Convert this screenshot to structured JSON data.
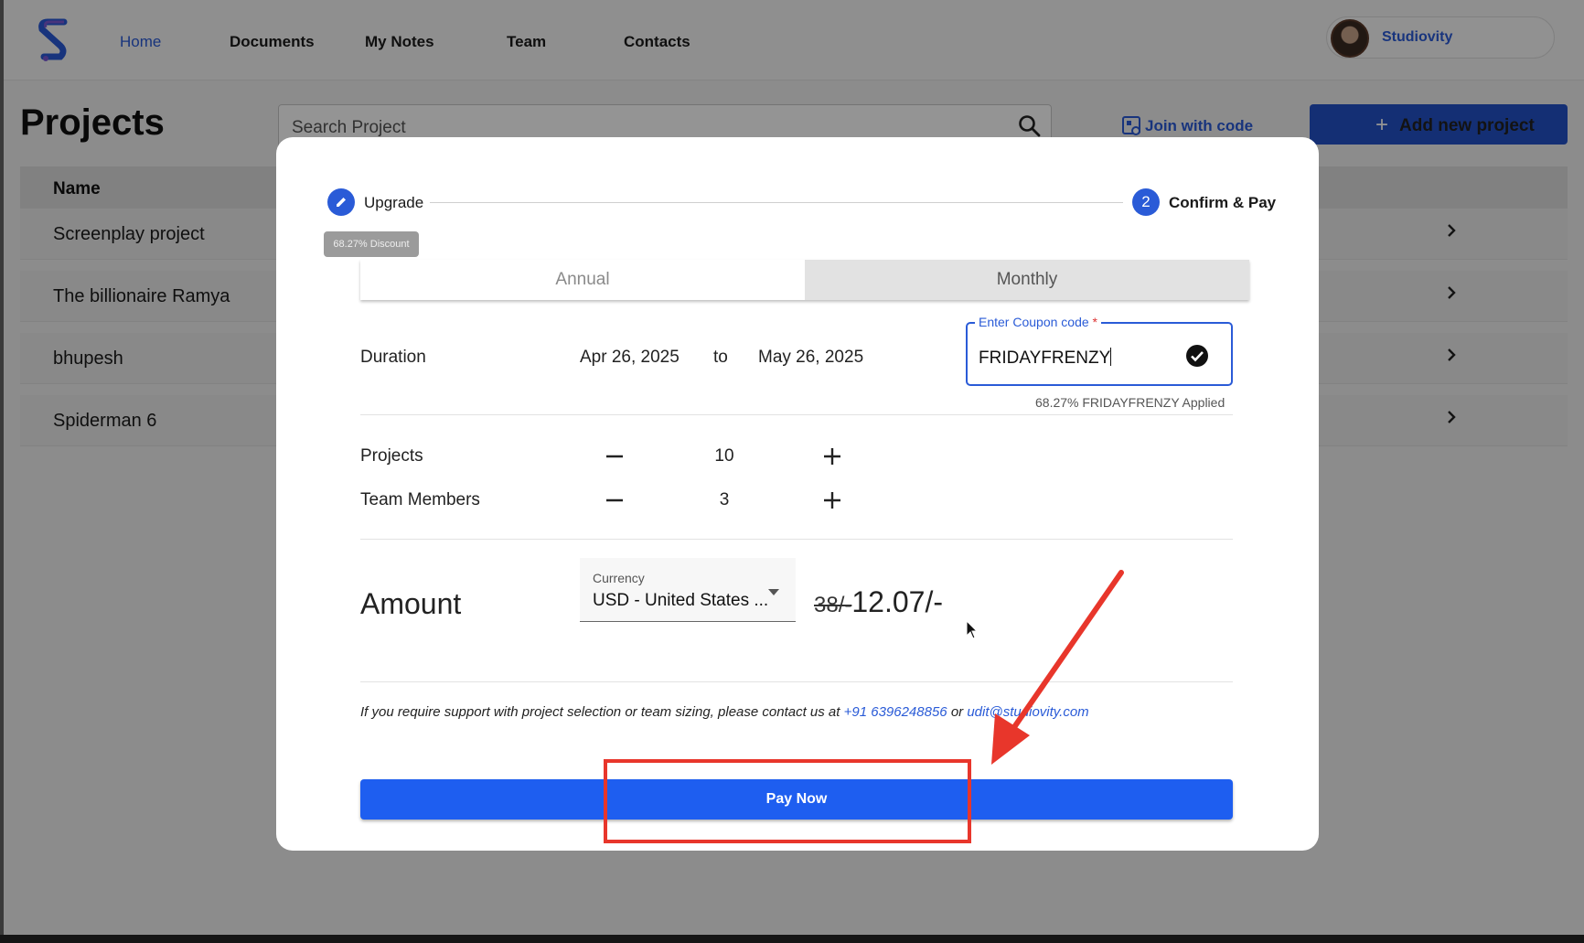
{
  "nav": {
    "links": [
      "Home",
      "Documents",
      "My Notes",
      "Team",
      "Contacts"
    ],
    "active": "Home",
    "profile_name": "Studiovity"
  },
  "page": {
    "title": "Projects",
    "search_placeholder": "Search Project",
    "join_with_code": "Join with code",
    "add_new_project": "Add new project"
  },
  "table": {
    "header": "Name",
    "rows": [
      "Screenplay project",
      "The billionaire Ramya",
      "bhupesh",
      "Spiderman 6"
    ]
  },
  "modal": {
    "steps": [
      {
        "number": "",
        "label": "Upgrade",
        "icon": "pencil-icon"
      },
      {
        "number": "2",
        "label": "Confirm & Pay"
      }
    ],
    "discount_tag": "68.27% Discount",
    "billing_options": [
      "Annual",
      "Monthly"
    ],
    "billing_selected": "Monthly",
    "duration": {
      "label": "Duration",
      "from": "Apr 26, 2025",
      "to_label": "to",
      "to": "May 26, 2025"
    },
    "coupon": {
      "label": "Enter Coupon code",
      "required_mark": "*",
      "value": "FRIDAYFRENZY",
      "applied_text": "68.27% FRIDAYFRENZY Applied"
    },
    "projects": {
      "label": "Projects",
      "count": "10"
    },
    "team_members": {
      "label": "Team Members",
      "count": "3"
    },
    "amount": {
      "label": "Amount",
      "currency_caption": "Currency",
      "currency_value": "USD - United States ...",
      "old_price": "38/-",
      "new_price": "12.07/-"
    },
    "support": {
      "text": "If you require support with project selection or team sizing, please contact us at",
      "phone": "+91 6396248856",
      "or": "or",
      "email": "udit@studiovity.com"
    },
    "pay_button": "Pay Now"
  },
  "colors": {
    "brand_blue": "#2a5bd7",
    "pay_button": "#1e5ef0",
    "annotation_red": "#e8362b"
  }
}
